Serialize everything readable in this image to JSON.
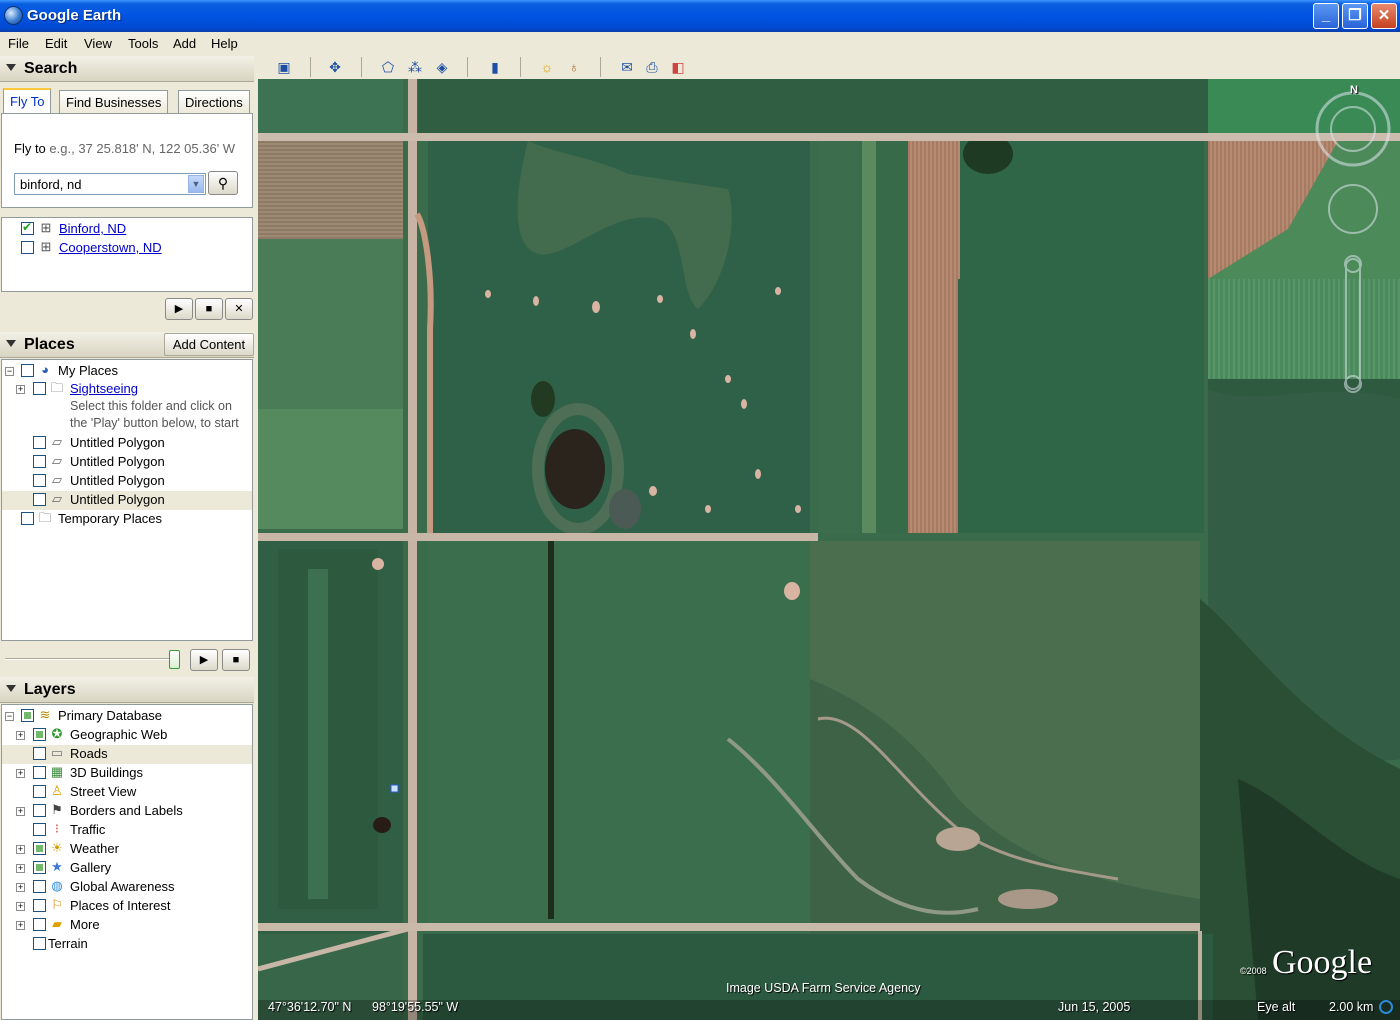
{
  "window": {
    "title": "Google Earth"
  },
  "menu": [
    "File",
    "Edit",
    "View",
    "Tools",
    "Add",
    "Help"
  ],
  "search": {
    "header": "Search",
    "tabs": [
      "Fly To",
      "Find Businesses",
      "Directions"
    ],
    "fly_to_label": "Fly to",
    "fly_to_example": "e.g., 37 25.818' N, 122 05.36' W",
    "query_value": "binford, nd",
    "results": [
      {
        "label": "Binford, ND",
        "checked": true
      },
      {
        "label": "Cooperstown, ND",
        "checked": false
      }
    ]
  },
  "places": {
    "header": "Places",
    "add_content": "Add Content",
    "my_places": "My Places",
    "sightseeing": "Sightseeing",
    "sightseeing_desc_1": "Select this folder and click on",
    "sightseeing_desc_2": "the 'Play' button below, to start",
    "polygons": [
      "Untitled Polygon",
      "Untitled Polygon",
      "Untitled Polygon",
      "Untitled Polygon"
    ],
    "temporary": "Temporary Places"
  },
  "layers": {
    "header": "Layers",
    "primary": "Primary Database",
    "items": [
      {
        "label": "Geographic Web",
        "icon": "globe-star-icon"
      },
      {
        "label": "Roads",
        "icon": "road-icon"
      },
      {
        "label": "3D Buildings",
        "icon": "building-icon"
      },
      {
        "label": "Street View",
        "icon": "pegman-icon"
      },
      {
        "label": "Borders and Labels",
        "icon": "flag-icon"
      },
      {
        "label": "Traffic",
        "icon": "traffic-light-icon"
      },
      {
        "label": "Weather",
        "icon": "sun-icon"
      },
      {
        "label": "Gallery",
        "icon": "star-icon"
      },
      {
        "label": "Global Awareness",
        "icon": "globe-icon"
      },
      {
        "label": "Places of Interest",
        "icon": "pin-icon"
      },
      {
        "label": "More",
        "icon": "folder-icon"
      }
    ],
    "terrain": "Terrain"
  },
  "status": {
    "lat": "47°36'12.70\" N",
    "lon": "98°19'55.55\" W",
    "attribution": "Image USDA Farm Service Agency",
    "date": "Jun 15, 2005",
    "eye_alt_label": "Eye alt",
    "eye_alt_value": "2.00 km",
    "copyright": "©2008",
    "logo": "Google",
    "compass_n": "N"
  },
  "colors": {
    "field_dark": "#2f5d44",
    "field_mid": "#3b6e4c",
    "road": "#c8b8a8",
    "tilled": "#a67862"
  }
}
